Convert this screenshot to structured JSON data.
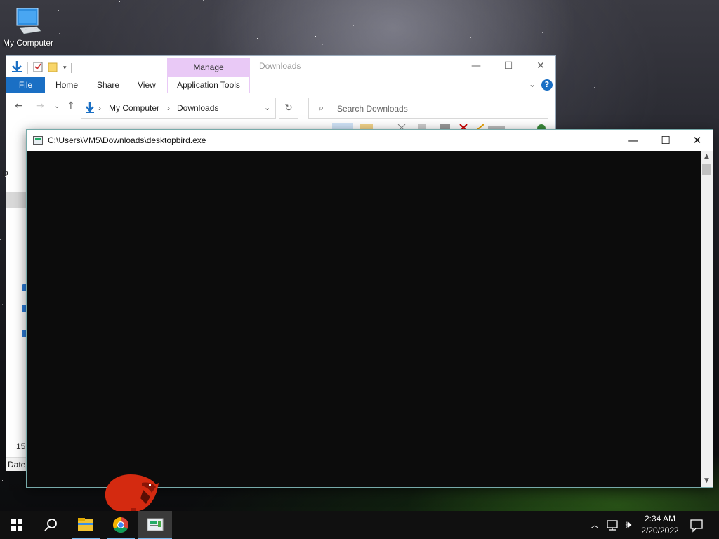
{
  "desktop": {
    "icons": [
      {
        "label": "My Computer",
        "icon": "computer-icon"
      }
    ]
  },
  "explorer": {
    "title": "Downloads",
    "contextual_tab": "Manage",
    "ribbon_tabs": [
      "File",
      "Home",
      "Share",
      "View",
      "Application Tools"
    ],
    "breadcrumb": [
      "My Computer",
      "Downloads"
    ],
    "search_placeholder": "Search Downloads",
    "status_count": "15",
    "column_header": "Date",
    "left_edge_letter": "D"
  },
  "console": {
    "title": "C:\\Users\\VM5\\Downloads\\desktopbird.exe",
    "background_color": "#0c0c0c"
  },
  "taskbar": {
    "apps": [
      "start-icon",
      "search-icon",
      "file-explorer-icon",
      "chrome-icon",
      "console-app-icon"
    ],
    "clock_time": "2:34 AM",
    "clock_date": "2/20/2022",
    "tray_icons": [
      "chevron-up-icon",
      "network-icon",
      "volume-icon",
      "notification-icon"
    ]
  },
  "colors": {
    "accent": "#1a6fc4",
    "manage_tab": "#e9c9f6",
    "taskbar": "#101010",
    "bird": "#d42a10"
  }
}
